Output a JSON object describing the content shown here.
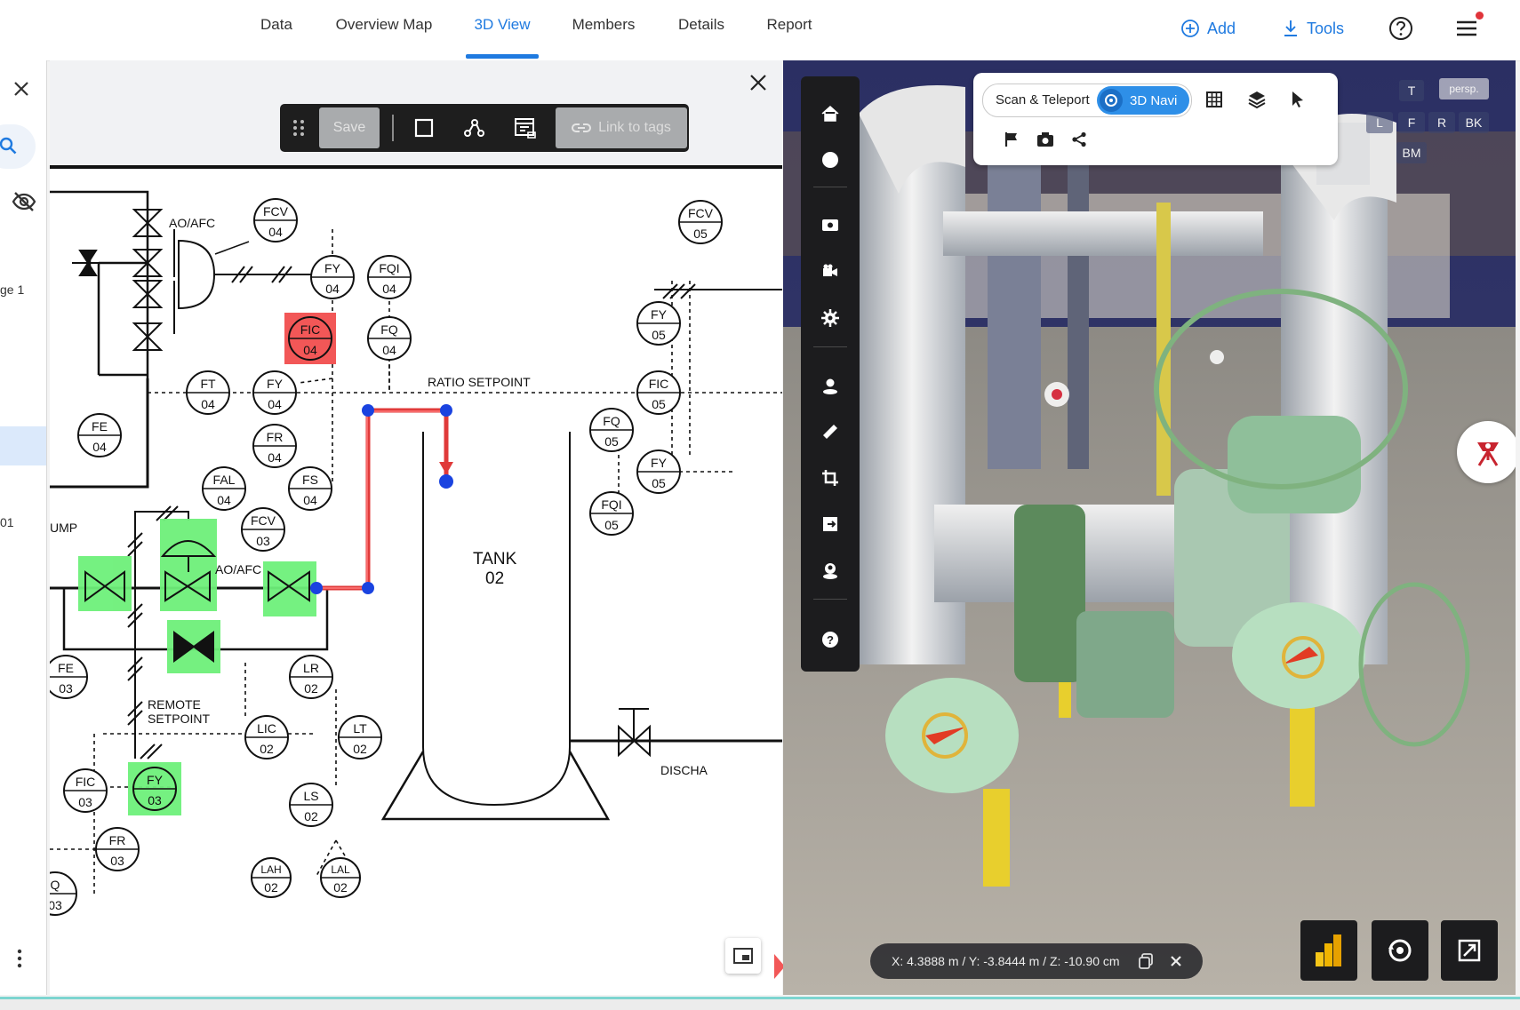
{
  "nav": {
    "tabs": [
      {
        "label": "Data"
      },
      {
        "label": "Overview Map"
      },
      {
        "label": "3D View"
      },
      {
        "label": "Members"
      },
      {
        "label": "Details"
      },
      {
        "label": "Report"
      }
    ],
    "active_tab": "3D View",
    "add_label": "Add",
    "tools_label": "Tools",
    "accent": "#1f7ae0"
  },
  "left_strip": {
    "page_label": "ge 1",
    "item_label": "01"
  },
  "pid_toolbar": {
    "save_label": "Save",
    "link_label": "Link to tags"
  },
  "pid_drawing": {
    "text_ao_afc_top": "AO/AFC",
    "text_ratio": "RATIO SETPOINT",
    "text_tank": "TANK",
    "text_tank_num": "02",
    "text_pump": "UMP",
    "text_ao_afc_bottom": "AO/AFC",
    "text_remote": "REMOTE",
    "text_setpoint": "SETPOINT",
    "text_discharge": "DISCHA",
    "instruments": [
      {
        "top": "FCV",
        "bottom": "04"
      },
      {
        "top": "FY",
        "bottom": "04"
      },
      {
        "top": "FQI",
        "bottom": "04"
      },
      {
        "top": "FIC",
        "bottom": "04"
      },
      {
        "top": "FQ",
        "bottom": "04"
      },
      {
        "top": "FT",
        "bottom": "04"
      },
      {
        "top": "FY",
        "bottom": "04"
      },
      {
        "top": "FE",
        "bottom": "04"
      },
      {
        "top": "FR",
        "bottom": "04"
      },
      {
        "top": "FAL",
        "bottom": "04"
      },
      {
        "top": "FS",
        "bottom": "04"
      },
      {
        "top": "FCV",
        "bottom": "03"
      },
      {
        "top": "FE",
        "bottom": "03"
      },
      {
        "top": "LR",
        "bottom": "02"
      },
      {
        "top": "LIC",
        "bottom": "02"
      },
      {
        "top": "LT",
        "bottom": "02"
      },
      {
        "top": "FIC",
        "bottom": "03"
      },
      {
        "top": "FY",
        "bottom": "03"
      },
      {
        "top": "LS",
        "bottom": "02"
      },
      {
        "top": "FR",
        "bottom": "03"
      },
      {
        "top": "LAH",
        "bottom": "02"
      },
      {
        "top": "LAL",
        "bottom": "02"
      },
      {
        "top": "Q",
        "bottom": "03"
      },
      {
        "top": "FCV",
        "bottom": "05"
      },
      {
        "top": "FY",
        "bottom": "05"
      },
      {
        "top": "FIC",
        "bottom": "05"
      },
      {
        "top": "FQ",
        "bottom": "05"
      },
      {
        "top": "FY",
        "bottom": "05"
      },
      {
        "top": "FQI",
        "bottom": "05"
      }
    ],
    "highlight_red": "#f25757",
    "highlight_green": "#6ef07a"
  },
  "view3d": {
    "scan_label": "Scan & Teleport",
    "navi_label": "3D Navi",
    "persp_label": "persp.",
    "cube": {
      "t": "T",
      "l": "L",
      "f": "F",
      "r": "R",
      "bk": "BK",
      "bm": "BM"
    },
    "coordinates": "X: 4.3888 m / Y: -3.8444 m / Z: -10.90 cm"
  }
}
